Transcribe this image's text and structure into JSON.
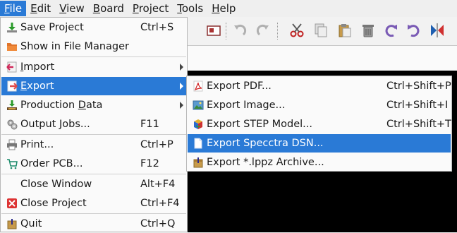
{
  "menubar": {
    "items": [
      {
        "label": "File",
        "mnemonic": "F",
        "rest": "ile"
      },
      {
        "label": "Edit",
        "mnemonic": "E",
        "rest": "dit"
      },
      {
        "label": "View",
        "mnemonic": "V",
        "rest": "iew"
      },
      {
        "label": "Board",
        "mnemonic": "B",
        "rest": "oard"
      },
      {
        "label": "Project",
        "mnemonic": "P",
        "rest": "roject"
      },
      {
        "label": "Tools",
        "mnemonic": "T",
        "rest": "ools"
      },
      {
        "label": "Help",
        "mnemonic": "H",
        "rest": "elp"
      }
    ]
  },
  "toolbar": {
    "icons": [
      "board-icon",
      "undo-icon",
      "redo-icon",
      "cut-icon",
      "copy-icon",
      "paste-icon",
      "delete-icon",
      "rotate-ccw-icon",
      "rotate-cw-icon",
      "flip-icon"
    ]
  },
  "file_menu": {
    "items": [
      {
        "label": "Save Project",
        "shortcut": "Ctrl+S",
        "icon": "save-icon"
      },
      {
        "label": "Show in File Manager",
        "shortcut": "",
        "icon": "folder-icon"
      },
      {
        "label": "Import",
        "shortcut": "",
        "icon": "import-icon",
        "submenu": true
      },
      {
        "label": "Export",
        "shortcut": "",
        "icon": "export-icon",
        "submenu": true,
        "highlighted": true
      },
      {
        "label": "Production Data",
        "shortcut": "",
        "icon": "production-data-icon",
        "submenu": true
      },
      {
        "label": "Output Jobs...",
        "shortcut": "F11",
        "icon": "output-jobs-icon"
      },
      {
        "label": "Print...",
        "shortcut": "Ctrl+P",
        "icon": "print-icon"
      },
      {
        "label": "Order PCB...",
        "shortcut": "F12",
        "icon": "cart-icon"
      },
      {
        "label": "Close Window",
        "shortcut": "Alt+F4",
        "icon": ""
      },
      {
        "label": "Close Project",
        "shortcut": "Ctrl+F4",
        "icon": "close-project-icon"
      },
      {
        "label": "Quit",
        "shortcut": "Ctrl+Q",
        "icon": "quit-icon"
      }
    ]
  },
  "export_submenu": {
    "items": [
      {
        "label": "Export PDF...",
        "shortcut": "Ctrl+Shift+P",
        "icon": "pdf-icon"
      },
      {
        "label": "Export Image...",
        "shortcut": "Ctrl+Shift+I",
        "icon": "image-icon"
      },
      {
        "label": "Export STEP Model...",
        "shortcut": "Ctrl+Shift+T",
        "icon": "step-model-icon"
      },
      {
        "label": "Export Specctra DSN...",
        "shortcut": "",
        "icon": "dsn-file-icon",
        "highlighted": true
      },
      {
        "label": "Export *.lppz Archive...",
        "shortcut": "",
        "icon": "archive-icon"
      }
    ]
  },
  "colors": {
    "highlight": "#2a7ad6",
    "canvas": "#000000"
  }
}
